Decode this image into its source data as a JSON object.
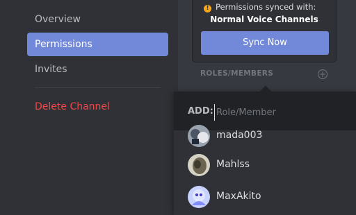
{
  "sidebar": {
    "items": [
      {
        "label": "Overview"
      },
      {
        "label": "Permissions"
      },
      {
        "label": "Invites"
      },
      {
        "label": "Delete Channel"
      }
    ]
  },
  "sync": {
    "message": "Permissions synced with:",
    "channel": "Normal Voice Channels",
    "button_label": "Sync Now"
  },
  "roles": {
    "header": "ROLES/MEMBERS",
    "add_icon": "plus-circle-icon"
  },
  "popup": {
    "add_label": "ADD:",
    "input_placeholder": "Role/Member",
    "members": [
      {
        "name": "mada003"
      },
      {
        "name": "Mahlss"
      },
      {
        "name": "MaxAkito"
      }
    ]
  },
  "colors": {
    "accent": "#7289da",
    "danger": "#f04747",
    "warning": "#faa61a"
  }
}
